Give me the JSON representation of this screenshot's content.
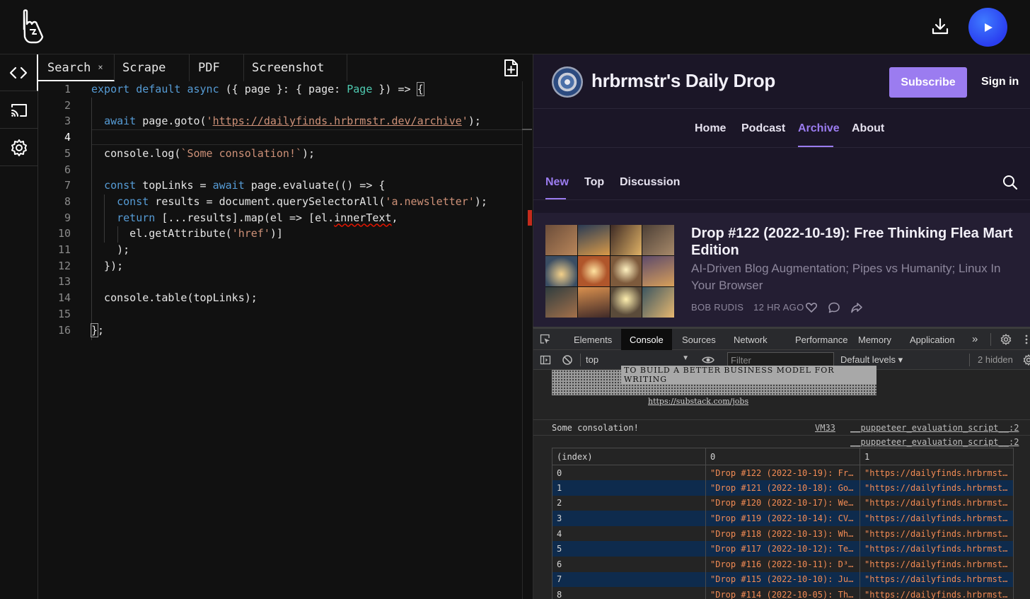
{
  "app": {
    "tabs": [
      {
        "label": "Search",
        "close": "×"
      },
      {
        "label": "Scrape"
      },
      {
        "label": "PDF"
      },
      {
        "label": "Screenshot"
      }
    ]
  },
  "editor": {
    "current_line": 4
  },
  "preview": {
    "site_title": "hrbrmstr's Daily Drop",
    "subscribe_label": "Subscribe",
    "signin_label": "Sign in",
    "nav": [
      "Home",
      "Podcast",
      "Archive",
      "About"
    ],
    "nav_active": "Archive",
    "filter_tabs": [
      "New",
      "Top",
      "Discussion"
    ],
    "filter_active": "New",
    "post": {
      "title": "Drop #122 (2022-10-19): Free Thinking Flea Mart Edition",
      "subtitle": "AI-Driven Blog Augmentation; Pipes vs Humanity; Linux In Your Browser",
      "author": "BOB RUDIS",
      "time": "12 HR AGO"
    }
  },
  "devtools": {
    "tabs": [
      "Elements",
      "Console",
      "Sources",
      "Network",
      "Performance",
      "Memory",
      "Application",
      "»"
    ],
    "active_tab": "Console",
    "context": "top",
    "filter_placeholder": "Filter",
    "levels": "Default levels ▾",
    "hidden": "2 hidden",
    "banner_text": "TO BUILD A BETTER BUSINESS MODEL FOR WRITING",
    "banner_link": "https://substack.com/jobs",
    "log_message": "Some consolation!",
    "log_source_vm": "VM33",
    "log_source_script": "__puppeteer_evaluation_script__:2",
    "table_source_script": "__puppeteer_evaluation_script__:2",
    "table": {
      "headers": [
        "(index)",
        "0",
        "1"
      ],
      "rows": [
        [
          "0",
          "\"Drop #122 (2022-10-19): Fr…",
          "\"https://dailyfinds.hrbrmst…"
        ],
        [
          "1",
          "\"Drop #121 (2022-10-18): Go…",
          "\"https://dailyfinds.hrbrmst…"
        ],
        [
          "2",
          "\"Drop #120 (2022-10-17): We…",
          "\"https://dailyfinds.hrbrmst…"
        ],
        [
          "3",
          "\"Drop #119 (2022-10-14): CV…",
          "\"https://dailyfinds.hrbrmst…"
        ],
        [
          "4",
          "\"Drop #118 (2022-10-13): Wh…",
          "\"https://dailyfinds.hrbrmst…"
        ],
        [
          "5",
          "\"Drop #117 (2022-10-12): Te…",
          "\"https://dailyfinds.hrbrmst…"
        ],
        [
          "6",
          "\"Drop #116 (2022-10-11): D³…",
          "\"https://dailyfinds.hrbrmst…"
        ],
        [
          "7",
          "\"Drop #115 (2022-10-10): Ju…",
          "\"https://dailyfinds.hrbrmst…"
        ],
        [
          "8",
          "\"Drop #114 (2022-10-05): Th…",
          "\"https://dailyfinds.hrbrmst…"
        ]
      ]
    }
  },
  "colors": {
    "accent_purple": "#9b7cf0",
    "run_button": "#2a3ef0",
    "keyword": "#569cd6",
    "type": "#4ec9b0",
    "string": "#ce9178",
    "table_string": "#f28b54"
  },
  "icons": {
    "logo": "logo-icon",
    "download": "download-icon",
    "run": "play-icon",
    "rail": [
      "code-icon",
      "cast-icon",
      "gear-icon"
    ],
    "new_file": "file-plus-icon",
    "search": "search-icon",
    "post_actions": [
      "heart-icon",
      "comment-icon",
      "share-icon"
    ]
  }
}
